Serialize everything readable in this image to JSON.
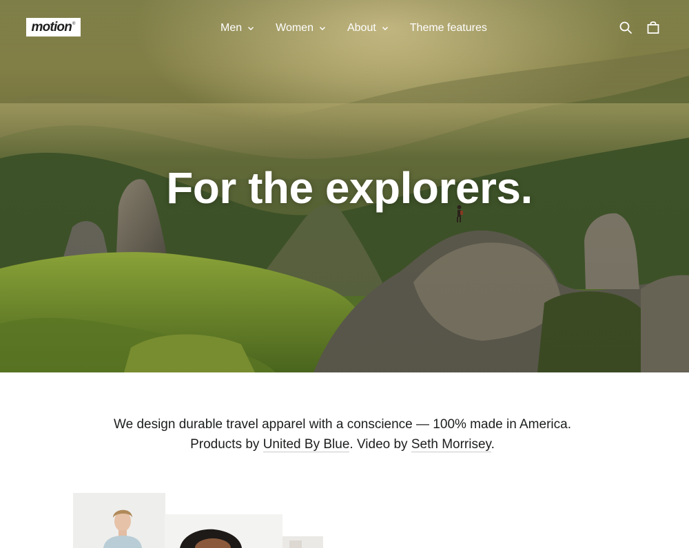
{
  "brand": {
    "logo_text": "motion",
    "logo_mark": "®"
  },
  "nav": {
    "items": [
      {
        "label": "Men",
        "has_dropdown": true
      },
      {
        "label": "Women",
        "has_dropdown": true
      },
      {
        "label": "About",
        "has_dropdown": true
      },
      {
        "label": "Theme features",
        "has_dropdown": false
      }
    ]
  },
  "header_icons": [
    "search-icon",
    "cart-icon"
  ],
  "hero": {
    "title": "For the explorers."
  },
  "intro": {
    "line1": "We design durable travel apparel with a conscience — 100% made in America.",
    "line2_prefix": "Products by ",
    "products_link": "United By Blue",
    "line2_mid": ". Video by ",
    "video_link": "Seth Morrisey",
    "line2_suffix": "."
  },
  "colors": {
    "text": "#1c1d1d",
    "background": "#ffffff",
    "nav_text": "#ffffff"
  }
}
